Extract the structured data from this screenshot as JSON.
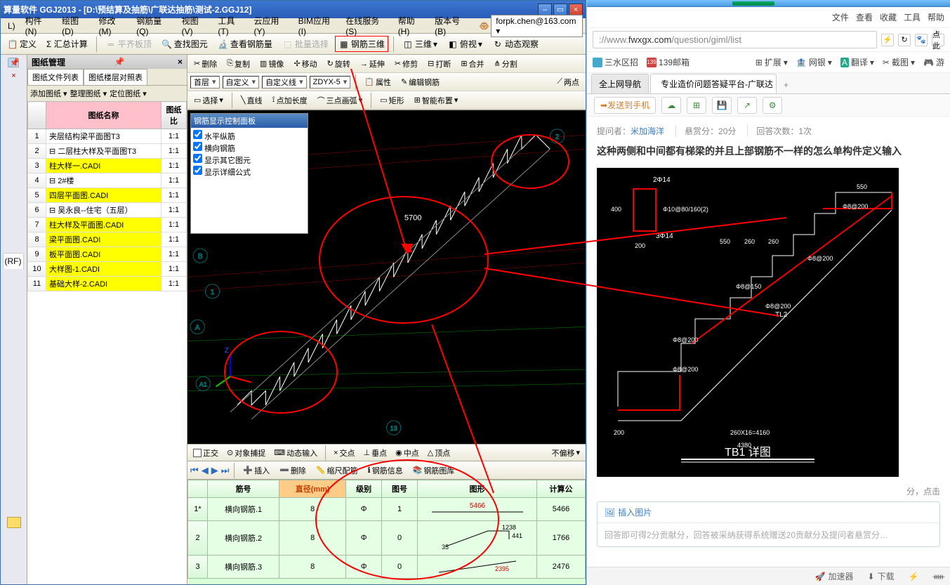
{
  "app": {
    "title": "算量软件 GGJ2013 - [D:\\预结算及抽筋\\广联达抽筋\\测试-2.GGJ12]",
    "email": "forpk.chen@163.com ▾"
  },
  "menus": [
    "L)",
    "构件(N)",
    "绘图(D)",
    "修改(M)",
    "钢筋量(Q)",
    "视图(V)",
    "工具(T)",
    "云应用(Y)",
    "BIM应用(I)",
    "在线服务(S)",
    "帮助(H)",
    "版本号(B)"
  ],
  "toolbar1": {
    "define": "定义",
    "sum": "Σ 汇总计算",
    "flatTop": "平齐板顶",
    "findElem": "查找图元",
    "checkRebar": "查看钢筋量",
    "batchSel": "批量选择",
    "rebar3d": "钢筋三维",
    "threeD": "三维",
    "ortho": "俯视",
    "dynObs": "动态观察"
  },
  "panel": {
    "title": "图纸管理",
    "tabs": [
      "图纸文件列表",
      "图纸楼层对照表"
    ],
    "subs": [
      "添加图纸 ▾",
      "整理图纸 ▾",
      "定位图纸 ▾"
    ],
    "headers": {
      "name": "图纸名称",
      "ratio": "图纸比"
    },
    "rows": [
      {
        "n": "1",
        "name": "夹层结构梁平面图T3",
        "ratio": "1:1",
        "yellow": false
      },
      {
        "n": "2",
        "name": "⊟ 二层柱大样及平面图T3",
        "ratio": "1:1",
        "yellow": false
      },
      {
        "n": "3",
        "name": "柱大样一.CADI",
        "ratio": "1:1",
        "yellow": true
      },
      {
        "n": "4",
        "name": "⊟ 2#楼",
        "ratio": "1:1",
        "yellow": false
      },
      {
        "n": "5",
        "name": "四层平面图.CADI",
        "ratio": "1:1",
        "yellow": true
      },
      {
        "n": "6",
        "name": "⊟ 吴永良--住宅（五层）",
        "ratio": "1:1",
        "yellow": false
      },
      {
        "n": "7",
        "name": "柱大样及平面图.CADI",
        "ratio": "1:1",
        "yellow": true
      },
      {
        "n": "8",
        "name": "梁平面图.CADI",
        "ratio": "1:1",
        "yellow": true
      },
      {
        "n": "9",
        "name": "板平面图.CADI",
        "ratio": "1:1",
        "yellow": true
      },
      {
        "n": "10",
        "name": "大样图-1.CADI",
        "ratio": "1:1",
        "yellow": true
      },
      {
        "n": "11",
        "name": "基础大样-2.CADI",
        "ratio": "1:1",
        "yellow": true
      }
    ]
  },
  "ctb1": {
    "delete": "删除",
    "copy": "复制",
    "mirror": "镜像",
    "move": "移动",
    "rotate": "旋转",
    "extend": "延伸",
    "trim": "修剪",
    "break": "打断",
    "merge": "合并",
    "split": "分割"
  },
  "ctb2": {
    "floor": "首层",
    "custom": "自定义",
    "custLine": "自定义线",
    "zdyx": "ZDYX-5",
    "props": "属性",
    "editRebar": "编辑钢筋",
    "twoPt": "两点"
  },
  "ctb3": {
    "select": "选择",
    "line": "直线",
    "ptLen": "点加长度",
    "arc3": "三点画弧",
    "rect": "矩形",
    "smart": "智能布置"
  },
  "controlPanel": {
    "title": "钢筋显示控制面板",
    "items": [
      "水平纵筋",
      "横向钢筋",
      "显示其它图元",
      "显示详细公式"
    ]
  },
  "viewport": {
    "labels": {
      "A": "A",
      "A1": "A1",
      "B": "B",
      "one": "1",
      "two": "2",
      "thirteen": "13",
      "Z": "Z"
    },
    "dim": "5700"
  },
  "snapbar": {
    "ortho": "正交",
    "osnap": "对象捕捉",
    "dyn": "动态输入",
    "inter": "交点",
    "perp": "垂点",
    "mid": "中点",
    "apex": "顶点",
    "noOffset": "不偏移"
  },
  "rebarTools": {
    "insert": "插入",
    "delete": "删除",
    "scale": "缩尺配筋",
    "info": "钢筋信息",
    "lib": "钢筋图库"
  },
  "rebarTable": {
    "headers": {
      "mark": "筋号",
      "dia": "直径(mm)",
      "level": "级别",
      "imgno": "图号",
      "shape": "图形",
      "formula": "计算公"
    },
    "rows": [
      {
        "n": "1*",
        "mark": "横向钢筋.1",
        "dia": "8",
        "level": "Φ",
        "imgno": "1",
        "shape": {
          "type": "line",
          "text": "5466"
        },
        "calc": "5466"
      },
      {
        "n": "2",
        "mark": "横向钢筋.2",
        "dia": "8",
        "level": "Φ",
        "imgno": "0",
        "shape": {
          "type": "zig",
          "a": "1238",
          "b": "441",
          "c": "35"
        },
        "calc": "1766"
      },
      {
        "n": "3",
        "mark": "横向钢筋.3",
        "dia": "8",
        "level": "Φ",
        "imgno": "0",
        "shape": {
          "type": "diag",
          "text": "2395"
        },
        "calc": "2476"
      }
    ]
  },
  "browser": {
    "menus": [
      "文件",
      "查看",
      "收藏",
      "工具",
      "帮助"
    ],
    "url": {
      "prefix": "://www.",
      "domain": "fwxgx.com",
      "path": "/question/giml/list"
    },
    "bookmarks": [
      "三水区招",
      "139邮箱"
    ],
    "bmTools": {
      "ext": "扩展",
      "bank": "网银",
      "trans": "翻译",
      "snip": "截图",
      "game": "游"
    },
    "tabs": [
      "全上网导航",
      "专业造价问题答疑平台-广联达"
    ],
    "sendPhone": "发送到手机",
    "q": {
      "asker": "提问者：",
      "askerName": "米加海洋",
      "bounty": "悬赏分：",
      "bountyVal": "20分",
      "answers": "回答次数：",
      "answersVal": "1次",
      "title": "这种两侧和中间都有梯梁的并且上部钢筋不一样的怎么单构件定义输入"
    },
    "fig": {
      "title": "TB1 详图",
      "labels": [
        "2Φ14",
        "Φ10@80/160(2)",
        "3Φ14",
        "400",
        "200",
        "550",
        "550",
        "260",
        "260",
        "Φ8@200",
        "Φ8@200",
        "Φ8@150",
        "Φ8@200",
        "Φ8@200",
        "Φ8@200",
        "TL2",
        "200",
        "260X16=4160",
        "4380"
      ]
    },
    "answerBox": {
      "insert": "插入图片",
      "hint": "回答即可得2分贡献分，回答被采纳获得系统赠送20贡献分及提问者悬赏分…"
    },
    "misc": {
      "pointHit": "分，点击"
    },
    "status": [
      "加速器",
      "下载",
      "⚡",
      "ᚔ"
    ]
  },
  "leftCol": {
    "rf": "(RF)"
  }
}
